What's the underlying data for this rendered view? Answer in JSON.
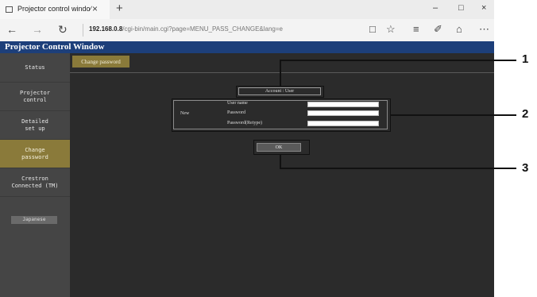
{
  "browser": {
    "tab_title": "Projector control windo∕",
    "tab_close": "×",
    "new_tab": "+",
    "address_host": "192.168.0.8",
    "address_path": "/cgi-bin/main.cgi?page=MENU_PASS_CHANGE&lang=e",
    "back": "←",
    "forward": "→",
    "refresh": "↻",
    "minimize": "–",
    "maximize": "□",
    "close": "×",
    "reading_view": "□",
    "favorite": "☆",
    "hub": "≡",
    "note": "✐",
    "share": "⌂",
    "more": "⋯"
  },
  "header": {
    "title": "Projector Control Window"
  },
  "sidebar": {
    "items": [
      {
        "label": "Status"
      },
      {
        "label": "Projector\ncontrol"
      },
      {
        "label": "Detailed\nset up"
      },
      {
        "label": "Change\npassword"
      },
      {
        "label": "Crestron\nConnected (TM)"
      }
    ],
    "active_index": 3,
    "language_button": "Japanese"
  },
  "main": {
    "change_password_button": "Change password",
    "account_label": "Account : User",
    "new_label": "New",
    "fields": [
      {
        "label": "User name",
        "value": ""
      },
      {
        "label": "Password",
        "value": ""
      },
      {
        "label": "Password(Retype)",
        "value": ""
      }
    ],
    "ok_button": "OK"
  },
  "callouts": [
    "1",
    "2",
    "3"
  ]
}
